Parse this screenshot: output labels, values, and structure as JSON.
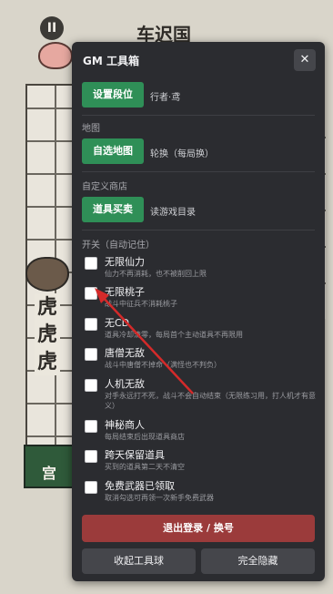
{
  "scene": {
    "pause_icon": "pause-icon",
    "city_title": "车迟国",
    "tiger_chars": [
      "虎",
      "虎",
      "虎"
    ],
    "palace_char": "宫"
  },
  "panel": {
    "title": "GM 工具箱",
    "close_icon": "close-icon",
    "sections": {
      "realm": {
        "button": "设置段位",
        "note": "行者·鸢"
      },
      "map": {
        "label": "地图",
        "button": "自选地图",
        "note": "轮换（每局换）"
      },
      "shop": {
        "label": "自定义商店",
        "button": "道具买卖",
        "note": "读游戏目录"
      },
      "toggles_label": "开关（自动记住）"
    },
    "toggles": [
      {
        "name": "无限仙力",
        "desc": "仙力不再消耗，也不被削回上限",
        "checked": false
      },
      {
        "name": "无限桃子",
        "desc": "战斗中征兵不消耗桃子",
        "checked": false
      },
      {
        "name": "无CD",
        "desc": "道具冷却清零，每局首个主动道具不再限用",
        "checked": false
      },
      {
        "name": "唐僧无敌",
        "desc": "战斗中唐僧不掉命（满怪也不判负）",
        "checked": false
      },
      {
        "name": "人机无敌",
        "desc": "对手永远打不死，战斗不会自动结束（无限练习用，打人机才有意义）",
        "checked": false
      },
      {
        "name": "神秘商人",
        "desc": "每局结束后出现道具商店",
        "checked": false
      },
      {
        "name": "跨天保留道具",
        "desc": "买到的道具第二天不清空",
        "checked": false
      },
      {
        "name": "免费武器已领取",
        "desc": "取消勾选可再领一次新手免费武器",
        "checked": false
      }
    ],
    "logout_button": "退出登录 / 换号",
    "collapse_button": "收起工具球",
    "hide_button": "完全隐藏"
  },
  "colors": {
    "panel_bg": "#2b2c30",
    "green": "#2f8f57",
    "red": "#9b3b3b",
    "arrow": "#d42a2a"
  }
}
